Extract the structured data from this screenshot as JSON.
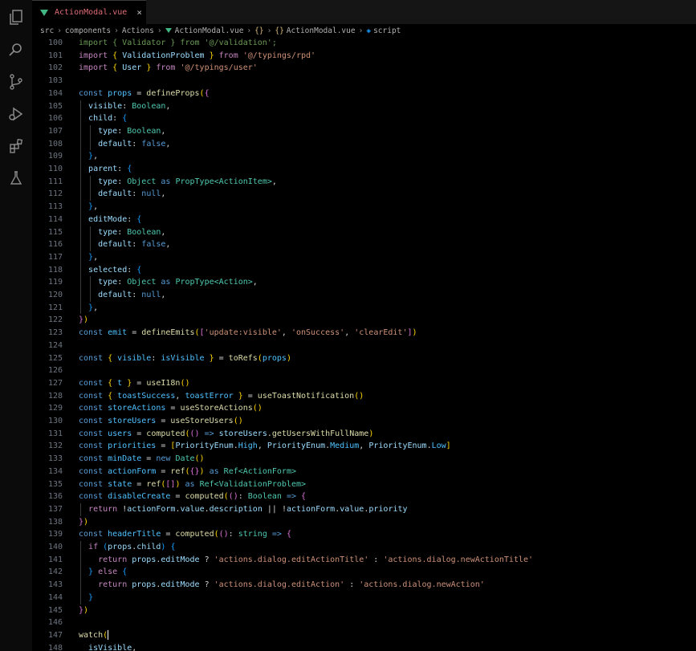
{
  "activity_bar": {
    "icons": [
      "files-icon",
      "search-icon",
      "source-control-icon",
      "run-debug-icon",
      "extensions-icon",
      "testing-icon"
    ]
  },
  "tab": {
    "label": "ActionModal.vue",
    "close": "×"
  },
  "breadcrumb": {
    "parts": [
      "src",
      "components",
      "Actions",
      "ActionModal.vue",
      "{}",
      "ActionModal.vue",
      "script"
    ]
  },
  "code_lines": [
    {
      "n": "100",
      "t": [
        [
          "com",
          "import { Validator } from '@/validation';"
        ]
      ]
    },
    {
      "n": "101",
      "t": [
        [
          "ctl",
          "import "
        ],
        [
          "br1",
          "{ "
        ],
        [
          "var",
          "ValidationProblem"
        ],
        [
          "br1",
          " }"
        ],
        [
          "ctl",
          " from "
        ],
        [
          "str",
          "'@/typings/rpd'"
        ]
      ]
    },
    {
      "n": "102",
      "t": [
        [
          "ctl",
          "import "
        ],
        [
          "br1",
          "{ "
        ],
        [
          "var",
          "User"
        ],
        [
          "br1",
          " }"
        ],
        [
          "ctl",
          " from "
        ],
        [
          "str",
          "'@/typings/user'"
        ]
      ]
    },
    {
      "n": "103",
      "t": []
    },
    {
      "n": "104",
      "t": [
        [
          "kw",
          "const "
        ],
        [
          "const",
          "props"
        ],
        [
          "pun",
          " = "
        ],
        [
          "fn",
          "defineProps"
        ],
        [
          "br1",
          "("
        ],
        [
          "br2",
          "{"
        ]
      ]
    },
    {
      "n": "105",
      "t": [
        [
          "pun",
          "  "
        ],
        [
          "var",
          "visible"
        ],
        [
          "pun",
          ": "
        ],
        [
          "ty",
          "Boolean"
        ],
        [
          "pun",
          ","
        ]
      ]
    },
    {
      "n": "106",
      "t": [
        [
          "pun",
          "  "
        ],
        [
          "var",
          "child"
        ],
        [
          "pun",
          ": "
        ],
        [
          "br3",
          "{"
        ]
      ]
    },
    {
      "n": "107",
      "t": [
        [
          "pun",
          "    "
        ],
        [
          "var",
          "type"
        ],
        [
          "pun",
          ": "
        ],
        [
          "ty",
          "Boolean"
        ],
        [
          "pun",
          ","
        ]
      ]
    },
    {
      "n": "108",
      "t": [
        [
          "pun",
          "    "
        ],
        [
          "var",
          "default"
        ],
        [
          "pun",
          ": "
        ],
        [
          "bool",
          "false"
        ],
        [
          "pun",
          ","
        ]
      ]
    },
    {
      "n": "109",
      "t": [
        [
          "pun",
          "  "
        ],
        [
          "br3",
          "}"
        ],
        [
          "pun",
          ","
        ]
      ]
    },
    {
      "n": "110",
      "t": [
        [
          "pun",
          "  "
        ],
        [
          "var",
          "parent"
        ],
        [
          "pun",
          ": "
        ],
        [
          "br3",
          "{"
        ]
      ]
    },
    {
      "n": "111",
      "t": [
        [
          "pun",
          "    "
        ],
        [
          "var",
          "type"
        ],
        [
          "pun",
          ": "
        ],
        [
          "ty",
          "Object"
        ],
        [
          "kw",
          " as "
        ],
        [
          "ty",
          "PropType<ActionItem>"
        ],
        [
          "pun",
          ","
        ]
      ]
    },
    {
      "n": "112",
      "t": [
        [
          "pun",
          "    "
        ],
        [
          "var",
          "default"
        ],
        [
          "pun",
          ": "
        ],
        [
          "bool",
          "null"
        ],
        [
          "pun",
          ","
        ]
      ]
    },
    {
      "n": "113",
      "t": [
        [
          "pun",
          "  "
        ],
        [
          "br3",
          "}"
        ],
        [
          "pun",
          ","
        ]
      ]
    },
    {
      "n": "114",
      "t": [
        [
          "pun",
          "  "
        ],
        [
          "var",
          "editMode"
        ],
        [
          "pun",
          ": "
        ],
        [
          "br3",
          "{"
        ]
      ]
    },
    {
      "n": "115",
      "t": [
        [
          "pun",
          "    "
        ],
        [
          "var",
          "type"
        ],
        [
          "pun",
          ": "
        ],
        [
          "ty",
          "Boolean"
        ],
        [
          "pun",
          ","
        ]
      ]
    },
    {
      "n": "116",
      "t": [
        [
          "pun",
          "    "
        ],
        [
          "var",
          "default"
        ],
        [
          "pun",
          ": "
        ],
        [
          "bool",
          "false"
        ],
        [
          "pun",
          ","
        ]
      ]
    },
    {
      "n": "117",
      "t": [
        [
          "pun",
          "  "
        ],
        [
          "br3",
          "}"
        ],
        [
          "pun",
          ","
        ]
      ]
    },
    {
      "n": "118",
      "t": [
        [
          "pun",
          "  "
        ],
        [
          "var",
          "selected"
        ],
        [
          "pun",
          ": "
        ],
        [
          "br3",
          "{"
        ]
      ]
    },
    {
      "n": "119",
      "t": [
        [
          "pun",
          "    "
        ],
        [
          "var",
          "type"
        ],
        [
          "pun",
          ": "
        ],
        [
          "ty",
          "Object"
        ],
        [
          "kw",
          " as "
        ],
        [
          "ty",
          "PropType<Action>"
        ],
        [
          "pun",
          ","
        ]
      ]
    },
    {
      "n": "120",
      "t": [
        [
          "pun",
          "    "
        ],
        [
          "var",
          "default"
        ],
        [
          "pun",
          ": "
        ],
        [
          "bool",
          "null"
        ],
        [
          "pun",
          ","
        ]
      ]
    },
    {
      "n": "121",
      "t": [
        [
          "pun",
          "  "
        ],
        [
          "br3",
          "}"
        ],
        [
          "pun",
          ","
        ]
      ]
    },
    {
      "n": "122",
      "t": [
        [
          "br2",
          "}"
        ],
        [
          "br1",
          ")"
        ]
      ]
    },
    {
      "n": "123",
      "t": [
        [
          "kw",
          "const "
        ],
        [
          "const",
          "emit"
        ],
        [
          "pun",
          " = "
        ],
        [
          "fn",
          "defineEmits"
        ],
        [
          "br1",
          "("
        ],
        [
          "br2",
          "["
        ],
        [
          "str",
          "'update:visible'"
        ],
        [
          "pun",
          ", "
        ],
        [
          "str",
          "'onSuccess'"
        ],
        [
          "pun",
          ", "
        ],
        [
          "str",
          "'clearEdit'"
        ],
        [
          "br2",
          "]"
        ],
        [
          "br1",
          ")"
        ]
      ]
    },
    {
      "n": "124",
      "t": []
    },
    {
      "n": "125",
      "t": [
        [
          "kw",
          "const "
        ],
        [
          "br1",
          "{ "
        ],
        [
          "const",
          "visible"
        ],
        [
          "pun",
          ": "
        ],
        [
          "const",
          "isVisible"
        ],
        [
          "br1",
          " }"
        ],
        [
          "pun",
          " = "
        ],
        [
          "fn",
          "toRefs"
        ],
        [
          "br1",
          "("
        ],
        [
          "const",
          "props"
        ],
        [
          "br1",
          ")"
        ]
      ]
    },
    {
      "n": "126",
      "t": []
    },
    {
      "n": "127",
      "t": [
        [
          "kw",
          "const "
        ],
        [
          "br1",
          "{ "
        ],
        [
          "const",
          "t"
        ],
        [
          "br1",
          " }"
        ],
        [
          "pun",
          " = "
        ],
        [
          "fn",
          "useI18n"
        ],
        [
          "br1",
          "()"
        ]
      ]
    },
    {
      "n": "128",
      "t": [
        [
          "kw",
          "const "
        ],
        [
          "br1",
          "{ "
        ],
        [
          "const",
          "toastSuccess"
        ],
        [
          "pun",
          ", "
        ],
        [
          "const",
          "toastError"
        ],
        [
          "br1",
          " }"
        ],
        [
          "pun",
          " = "
        ],
        [
          "fn",
          "useToastNotification"
        ],
        [
          "br1",
          "()"
        ]
      ]
    },
    {
      "n": "129",
      "t": [
        [
          "kw",
          "const "
        ],
        [
          "const",
          "storeActions"
        ],
        [
          "pun",
          " = "
        ],
        [
          "fn",
          "useStoreActions"
        ],
        [
          "br1",
          "()"
        ]
      ]
    },
    {
      "n": "130",
      "t": [
        [
          "kw",
          "const "
        ],
        [
          "const",
          "storeUsers"
        ],
        [
          "pun",
          " = "
        ],
        [
          "fn",
          "useStoreUsers"
        ],
        [
          "br1",
          "()"
        ]
      ]
    },
    {
      "n": "131",
      "t": [
        [
          "kw",
          "const "
        ],
        [
          "const",
          "users"
        ],
        [
          "pun",
          " = "
        ],
        [
          "fn",
          "computed"
        ],
        [
          "br1",
          "("
        ],
        [
          "br2",
          "()"
        ],
        [
          "kw",
          " => "
        ],
        [
          "var",
          "storeUsers"
        ],
        [
          "pun",
          "."
        ],
        [
          "fn",
          "getUsersWithFullName"
        ],
        [
          "br1",
          ")"
        ]
      ]
    },
    {
      "n": "132",
      "t": [
        [
          "kw",
          "const "
        ],
        [
          "const",
          "priorities"
        ],
        [
          "pun",
          " = "
        ],
        [
          "br1",
          "["
        ],
        [
          "var",
          "PriorityEnum"
        ],
        [
          "pun",
          "."
        ],
        [
          "const",
          "High"
        ],
        [
          "pun",
          ", "
        ],
        [
          "var",
          "PriorityEnum"
        ],
        [
          "pun",
          "."
        ],
        [
          "const",
          "Medium"
        ],
        [
          "pun",
          ", "
        ],
        [
          "var",
          "PriorityEnum"
        ],
        [
          "pun",
          "."
        ],
        [
          "const",
          "Low"
        ],
        [
          "br1",
          "]"
        ]
      ]
    },
    {
      "n": "133",
      "t": [
        [
          "kw",
          "const "
        ],
        [
          "const",
          "minDate"
        ],
        [
          "pun",
          " = "
        ],
        [
          "kw",
          "new "
        ],
        [
          "ty",
          "Date"
        ],
        [
          "br1",
          "()"
        ]
      ]
    },
    {
      "n": "134",
      "t": [
        [
          "kw",
          "const "
        ],
        [
          "const",
          "actionForm"
        ],
        [
          "pun",
          " = "
        ],
        [
          "fn",
          "ref"
        ],
        [
          "br1",
          "("
        ],
        [
          "br2",
          "{}"
        ],
        [
          "br1",
          ")"
        ],
        [
          "kw",
          " as "
        ],
        [
          "ty",
          "Ref<ActionForm>"
        ]
      ]
    },
    {
      "n": "135",
      "t": [
        [
          "kw",
          "const "
        ],
        [
          "const",
          "state"
        ],
        [
          "pun",
          " = "
        ],
        [
          "fn",
          "ref"
        ],
        [
          "br1",
          "("
        ],
        [
          "br2",
          "[]"
        ],
        [
          "br1",
          ")"
        ],
        [
          "kw",
          " as "
        ],
        [
          "ty",
          "Ref<ValidationProblem>"
        ]
      ]
    },
    {
      "n": "136",
      "t": [
        [
          "kw",
          "const "
        ],
        [
          "const",
          "disableCreate"
        ],
        [
          "pun",
          " = "
        ],
        [
          "fn",
          "computed"
        ],
        [
          "br1",
          "("
        ],
        [
          "br2",
          "()"
        ],
        [
          "pun",
          ": "
        ],
        [
          "ty",
          "Boolean"
        ],
        [
          "kw",
          " => "
        ],
        [
          "br2",
          "{"
        ]
      ]
    },
    {
      "n": "137",
      "t": [
        [
          "pun",
          "  "
        ],
        [
          "ctl",
          "return "
        ],
        [
          "pun",
          "!"
        ],
        [
          "var",
          "actionForm"
        ],
        [
          "pun",
          "."
        ],
        [
          "var",
          "value"
        ],
        [
          "pun",
          "."
        ],
        [
          "var",
          "description"
        ],
        [
          "pun",
          " || !"
        ],
        [
          "var",
          "actionForm"
        ],
        [
          "pun",
          "."
        ],
        [
          "var",
          "value"
        ],
        [
          "pun",
          "."
        ],
        [
          "var",
          "priority"
        ]
      ]
    },
    {
      "n": "138",
      "t": [
        [
          "br2",
          "}"
        ],
        [
          "br1",
          ")"
        ]
      ]
    },
    {
      "n": "139",
      "t": [
        [
          "kw",
          "const "
        ],
        [
          "const",
          "headerTitle"
        ],
        [
          "pun",
          " = "
        ],
        [
          "fn",
          "computed"
        ],
        [
          "br1",
          "("
        ],
        [
          "br2",
          "()"
        ],
        [
          "pun",
          ": "
        ],
        [
          "ty",
          "string"
        ],
        [
          "kw",
          " => "
        ],
        [
          "br2",
          "{"
        ]
      ]
    },
    {
      "n": "140",
      "t": [
        [
          "pun",
          "  "
        ],
        [
          "ctl",
          "if "
        ],
        [
          "br3",
          "("
        ],
        [
          "var",
          "props"
        ],
        [
          "pun",
          "."
        ],
        [
          "var",
          "child"
        ],
        [
          "br3",
          ")"
        ],
        [
          "br3",
          " {"
        ]
      ]
    },
    {
      "n": "141",
      "t": [
        [
          "pun",
          "    "
        ],
        [
          "ctl",
          "return "
        ],
        [
          "var",
          "props"
        ],
        [
          "pun",
          "."
        ],
        [
          "var",
          "editMode"
        ],
        [
          "pun",
          " ? "
        ],
        [
          "str",
          "'actions.dialog.editActionTitle'"
        ],
        [
          "pun",
          " : "
        ],
        [
          "str",
          "'actions.dialog.newActionTitle'"
        ]
      ]
    },
    {
      "n": "142",
      "t": [
        [
          "pun",
          "  "
        ],
        [
          "br3",
          "}"
        ],
        [
          "ctl",
          " else "
        ],
        [
          "br3",
          "{"
        ]
      ]
    },
    {
      "n": "143",
      "t": [
        [
          "pun",
          "    "
        ],
        [
          "ctl",
          "return "
        ],
        [
          "var",
          "props"
        ],
        [
          "pun",
          "."
        ],
        [
          "var",
          "editMode"
        ],
        [
          "pun",
          " ? "
        ],
        [
          "str",
          "'actions.dialog.editAction'"
        ],
        [
          "pun",
          " : "
        ],
        [
          "str",
          "'actions.dialog.newAction'"
        ]
      ]
    },
    {
      "n": "144",
      "t": [
        [
          "pun",
          "  "
        ],
        [
          "br3",
          "}"
        ]
      ]
    },
    {
      "n": "145",
      "t": [
        [
          "br2",
          "}"
        ],
        [
          "br1",
          ")"
        ]
      ]
    },
    {
      "n": "146",
      "t": []
    },
    {
      "n": "147",
      "t": [
        [
          "fn",
          "watch"
        ],
        [
          "br1",
          "("
        ]
      ]
    },
    {
      "n": "148",
      "t": [
        [
          "pun",
          "  "
        ],
        [
          "var",
          "isVisible"
        ],
        [
          "pun",
          ","
        ]
      ]
    }
  ]
}
